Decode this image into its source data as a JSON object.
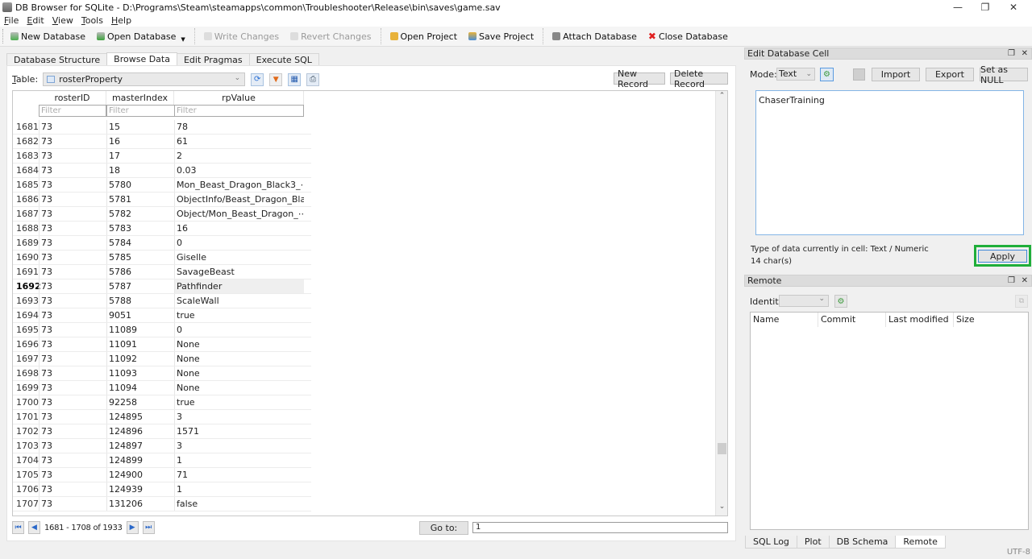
{
  "window": {
    "title": "DB Browser for SQLite - D:\\Programs\\Steam\\steamapps\\common\\Troubleshooter\\Release\\bin\\saves\\game.sav",
    "minimize_icon": "minimize-icon",
    "maximize_icon": "restore-icon",
    "close_icon": "close-icon"
  },
  "menu": [
    {
      "label": "File",
      "accel": "F",
      "rest": "ile"
    },
    {
      "label": "Edit",
      "accel": "E",
      "rest": "dit"
    },
    {
      "label": "View",
      "accel": "V",
      "rest": "iew"
    },
    {
      "label": "Tools",
      "accel": "T",
      "rest": "ools"
    },
    {
      "label": "Help",
      "accel": "H",
      "rest": "elp"
    }
  ],
  "toolbar": {
    "new_database": "New Database",
    "open_database": "Open Database",
    "write_changes": "Write Changes",
    "revert_changes": "Revert Changes",
    "open_project": "Open Project",
    "save_project": "Save Project",
    "attach_database": "Attach Database",
    "close_database": "Close Database"
  },
  "tabs": [
    "Database Structure",
    "Browse Data",
    "Edit Pragmas",
    "Execute SQL"
  ],
  "active_tab": "Browse Data",
  "browse": {
    "table_label": "Table:",
    "table_name": "rosterProperty",
    "new_record": "New Record",
    "delete_record": "Delete Record",
    "columns": [
      "rosterID",
      "masterIndex",
      "rpValue"
    ],
    "filter_placeholder": "Filter",
    "selected_row": "1692",
    "rows": [
      {
        "n": "1681",
        "rosterID": "73",
        "masterIndex": "15",
        "rpValue": "78"
      },
      {
        "n": "1682",
        "rosterID": "73",
        "masterIndex": "16",
        "rpValue": "61"
      },
      {
        "n": "1683",
        "rosterID": "73",
        "masterIndex": "17",
        "rpValue": "2"
      },
      {
        "n": "1684",
        "rosterID": "73",
        "masterIndex": "18",
        "rpValue": "0.03"
      },
      {
        "n": "1685",
        "rosterID": "73",
        "masterIndex": "5780",
        "rpValue": "Mon_Beast_Dragon_Black3_⋯"
      },
      {
        "n": "1686",
        "rosterID": "73",
        "masterIndex": "5781",
        "rpValue": "ObjectInfo/Beast_Dragon_Bla⋯"
      },
      {
        "n": "1687",
        "rosterID": "73",
        "masterIndex": "5782",
        "rpValue": "Object/Mon_Beast_Dragon_⋯"
      },
      {
        "n": "1688",
        "rosterID": "73",
        "masterIndex": "5783",
        "rpValue": "16"
      },
      {
        "n": "1689",
        "rosterID": "73",
        "masterIndex": "5784",
        "rpValue": "0"
      },
      {
        "n": "1690",
        "rosterID": "73",
        "masterIndex": "5785",
        "rpValue": "Giselle"
      },
      {
        "n": "1691",
        "rosterID": "73",
        "masterIndex": "5786",
        "rpValue": "SavageBeast"
      },
      {
        "n": "1692",
        "rosterID": "73",
        "masterIndex": "5787",
        "rpValue": "Pathfinder"
      },
      {
        "n": "1693",
        "rosterID": "73",
        "masterIndex": "5788",
        "rpValue": "ScaleWall"
      },
      {
        "n": "1694",
        "rosterID": "73",
        "masterIndex": "9051",
        "rpValue": "true"
      },
      {
        "n": "1695",
        "rosterID": "73",
        "masterIndex": "11089",
        "rpValue": "0"
      },
      {
        "n": "1696",
        "rosterID": "73",
        "masterIndex": "11091",
        "rpValue": "None"
      },
      {
        "n": "1697",
        "rosterID": "73",
        "masterIndex": "11092",
        "rpValue": "None"
      },
      {
        "n": "1698",
        "rosterID": "73",
        "masterIndex": "11093",
        "rpValue": "None"
      },
      {
        "n": "1699",
        "rosterID": "73",
        "masterIndex": "11094",
        "rpValue": "None"
      },
      {
        "n": "1700",
        "rosterID": "73",
        "masterIndex": "92258",
        "rpValue": "true"
      },
      {
        "n": "1701",
        "rosterID": "73",
        "masterIndex": "124895",
        "rpValue": "3"
      },
      {
        "n": "1702",
        "rosterID": "73",
        "masterIndex": "124896",
        "rpValue": "1571"
      },
      {
        "n": "1703",
        "rosterID": "73",
        "masterIndex": "124897",
        "rpValue": "3"
      },
      {
        "n": "1704",
        "rosterID": "73",
        "masterIndex": "124899",
        "rpValue": "1"
      },
      {
        "n": "1705",
        "rosterID": "73",
        "masterIndex": "124900",
        "rpValue": "71"
      },
      {
        "n": "1706",
        "rosterID": "73",
        "masterIndex": "124939",
        "rpValue": "1"
      },
      {
        "n": "1707",
        "rosterID": "73",
        "masterIndex": "131206",
        "rpValue": "false"
      }
    ],
    "pager_text": "1681 - 1708 of 1933",
    "goto_label": "Go to:",
    "goto_value": "1",
    "scroll_position_fraction": 0.87
  },
  "edit_cell": {
    "title": "Edit Database Cell",
    "mode_label": "Mode:",
    "mode_value": "Text",
    "import": "Import",
    "export": "Export",
    "set_null": "Set as NULL",
    "content": "ChaserTraining",
    "type_info": "Type of data currently in cell: Text / Numeric",
    "char_count": "14 char(s)",
    "apply": "Apply",
    "highlight_color": "#1fae3a"
  },
  "remote": {
    "title": "Remote",
    "identity_label": "Identity",
    "identity_value": "",
    "columns": [
      "Name",
      "Commit",
      "Last modified",
      "Size"
    ]
  },
  "bottom_tabs": [
    "SQL Log",
    "Plot",
    "DB Schema",
    "Remote"
  ],
  "bottom_active": "Remote",
  "status_encoding": "UTF-8"
}
